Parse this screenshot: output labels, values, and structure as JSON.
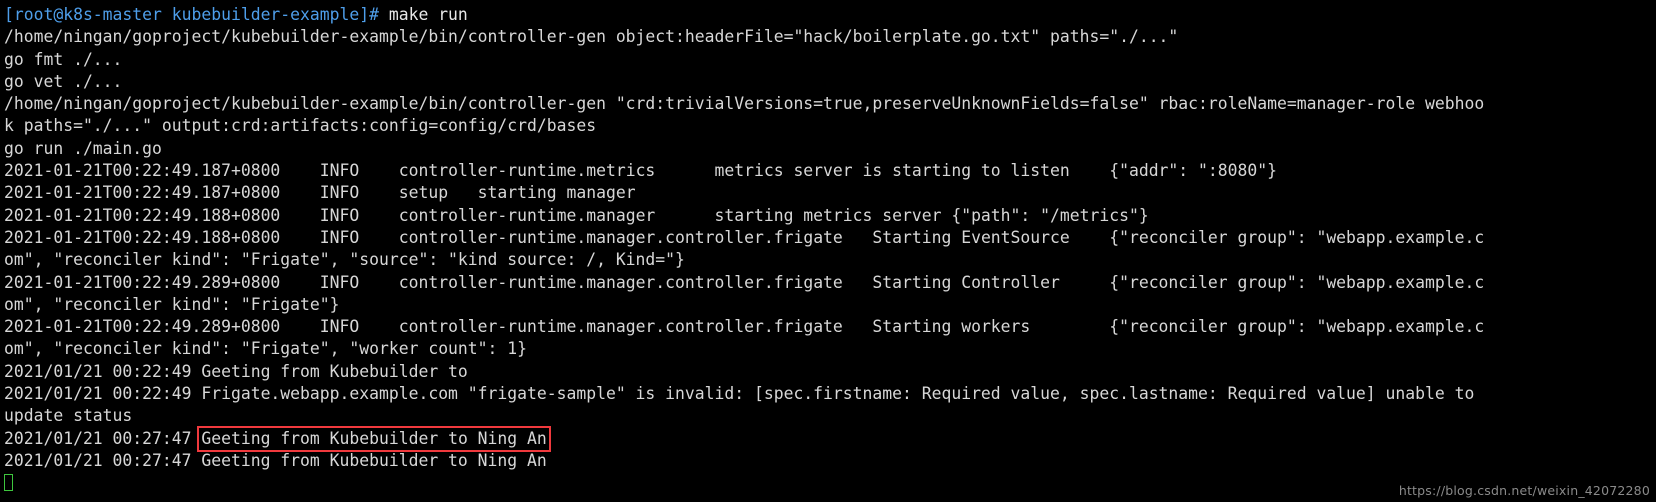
{
  "terminal": {
    "background_color": "#000000",
    "foreground_color": "#d7d7d7",
    "prompt_color": "#4e9eea",
    "highlight_color": "#f0393d",
    "cursor_color": "#3ec63e",
    "prompt": "[root@k8s-master kubebuilder-example]#",
    "command": " make run",
    "lines": [
      "/home/ningan/goproject/kubebuilder-example/bin/controller-gen object:headerFile=\"hack/boilerplate.go.txt\" paths=\"./...\"",
      "go fmt ./...",
      "go vet ./...",
      "/home/ningan/goproject/kubebuilder-example/bin/controller-gen \"crd:trivialVersions=true,preserveUnknownFields=false\" rbac:roleName=manager-role webhoo",
      "k paths=\"./...\" output:crd:artifacts:config=config/crd/bases",
      "go run ./main.go",
      "2021-01-21T00:22:49.187+0800\tINFO\tcontroller-runtime.metrics\tmetrics server is starting to listen\t{\"addr\": \":8080\"}",
      "2021-01-21T00:22:49.187+0800\tINFO\tsetup\tstarting manager",
      "2021-01-21T00:22:49.188+0800\tINFO\tcontroller-runtime.manager\tstarting metrics server\t{\"path\": \"/metrics\"}",
      "2021-01-21T00:22:49.188+0800\tINFO\tcontroller-runtime.manager.controller.frigate\tStarting EventSource\t{\"reconciler group\": \"webapp.example.c",
      "om\", \"reconciler kind\": \"Frigate\", \"source\": \"kind source: /, Kind=\"}",
      "2021-01-21T00:22:49.289+0800\tINFO\tcontroller-runtime.manager.controller.frigate\tStarting Controller\t{\"reconciler group\": \"webapp.example.c",
      "om\", \"reconciler kind\": \"Frigate\"}",
      "2021-01-21T00:22:49.289+0800\tINFO\tcontroller-runtime.manager.controller.frigate\tStarting workers\t{\"reconciler group\": \"webapp.example.c",
      "om\", \"reconciler kind\": \"Frigate\", \"worker count\": 1}",
      "2021/01/21 00:22:49 Geeting from Kubebuilder to",
      "2021/01/21 00:22:49 Frigate.webapp.example.com \"frigate-sample\" is invalid: [spec.firstname: Required value, spec.lastname: Required value] unable to",
      "update status"
    ],
    "highlighted_line": {
      "prefix": "2021/01/21 00:27:47 ",
      "boxed_text": "Geeting from Kubebuilder to Ning An"
    },
    "last_line": "2021/01/21 00:27:47 Geeting from Kubebuilder to Ning An"
  },
  "watermark": {
    "text": "https://blog.csdn.net/weixin_42072280"
  }
}
